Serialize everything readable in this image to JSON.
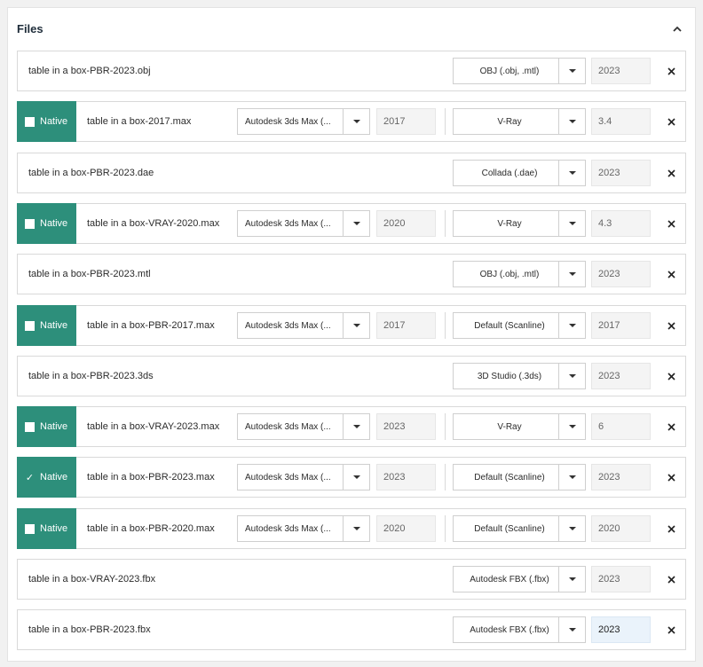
{
  "panel": {
    "title": "Files"
  },
  "native_label": "Native",
  "rows": [
    {
      "filename": "table in a box-PBR-2023.obj",
      "renderer": "OBJ (.obj, .mtl)",
      "renderer_version": "2023"
    },
    {
      "native": false,
      "filename": "table in a box-2017.max",
      "app": "Autodesk 3ds Max (...",
      "app_version": "2017",
      "renderer": "V-Ray",
      "renderer_version": "3.4"
    },
    {
      "filename": "table in a box-PBR-2023.dae",
      "renderer": "Collada (.dae)",
      "renderer_version": "2023"
    },
    {
      "native": false,
      "filename": "table in a box-VRAY-2020.max",
      "app": "Autodesk 3ds Max (...",
      "app_version": "2020",
      "renderer": "V-Ray",
      "renderer_version": "4.3"
    },
    {
      "filename": "table in a box-PBR-2023.mtl",
      "renderer": "OBJ (.obj, .mtl)",
      "renderer_version": "2023"
    },
    {
      "native": false,
      "filename": "table in a box-PBR-2017.max",
      "app": "Autodesk 3ds Max (...",
      "app_version": "2017",
      "renderer": "Default (Scanline)",
      "renderer_version": "2017"
    },
    {
      "filename": "table in a box-PBR-2023.3ds",
      "renderer": "3D Studio (.3ds)",
      "renderer_version": "2023"
    },
    {
      "native": false,
      "filename": "table in a box-VRAY-2023.max",
      "app": "Autodesk 3ds Max (...",
      "app_version": "2023",
      "renderer": "V-Ray",
      "renderer_version": "6"
    },
    {
      "native": true,
      "filename": "table in a box-PBR-2023.max",
      "app": "Autodesk 3ds Max (...",
      "app_version": "2023",
      "renderer": "Default (Scanline)",
      "renderer_version": "2023"
    },
    {
      "native": false,
      "filename": "table in a box-PBR-2020.max",
      "app": "Autodesk 3ds Max (...",
      "app_version": "2020",
      "renderer": "Default (Scanline)",
      "renderer_version": "2020"
    },
    {
      "filename": "table in a box-VRAY-2023.fbx",
      "renderer": "Autodesk FBX (.fbx)",
      "renderer_version": "2023"
    },
    {
      "filename": "table in a box-PBR-2023.fbx",
      "renderer": "Autodesk FBX (.fbx)",
      "renderer_version": "2023",
      "active": true
    }
  ]
}
